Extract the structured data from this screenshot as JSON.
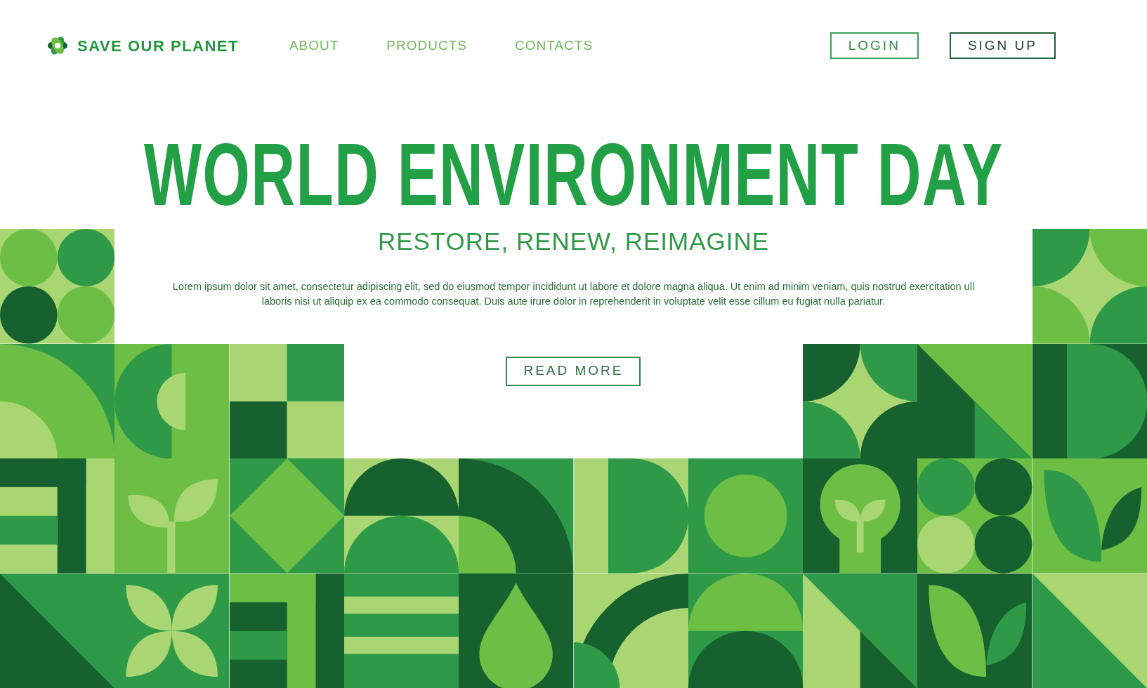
{
  "header": {
    "brand": "SAVE OUR PLANET",
    "nav": [
      {
        "label": "ABOUT"
      },
      {
        "label": "PRODUCTS"
      },
      {
        "label": "CONTACTS"
      }
    ],
    "auth_buttons": [
      {
        "label": "LOGIN",
        "kind": "light"
      },
      {
        "label": "SIGN UP",
        "kind": "dark"
      }
    ]
  },
  "hero": {
    "title": "WORLD ENVIRONMENT DAY",
    "subtitle": "RESTORE, RENEW, REIMAGINE",
    "body": "Lorem ipsum dolor sit amet, consectetur adipiscing elit, sed do eiusmod tempor incididunt ut labore et dolore magna aliqua. Ut enim ad minim veniam, quis nostrud exercitation ull  laboris nisi ut aliquip ex ea commodo consequat. Duis aute irure dolor in reprehenderit in voluptate velit esse cillum eu fugiat nulla pariatur.",
    "button": "READ MORE"
  }
}
